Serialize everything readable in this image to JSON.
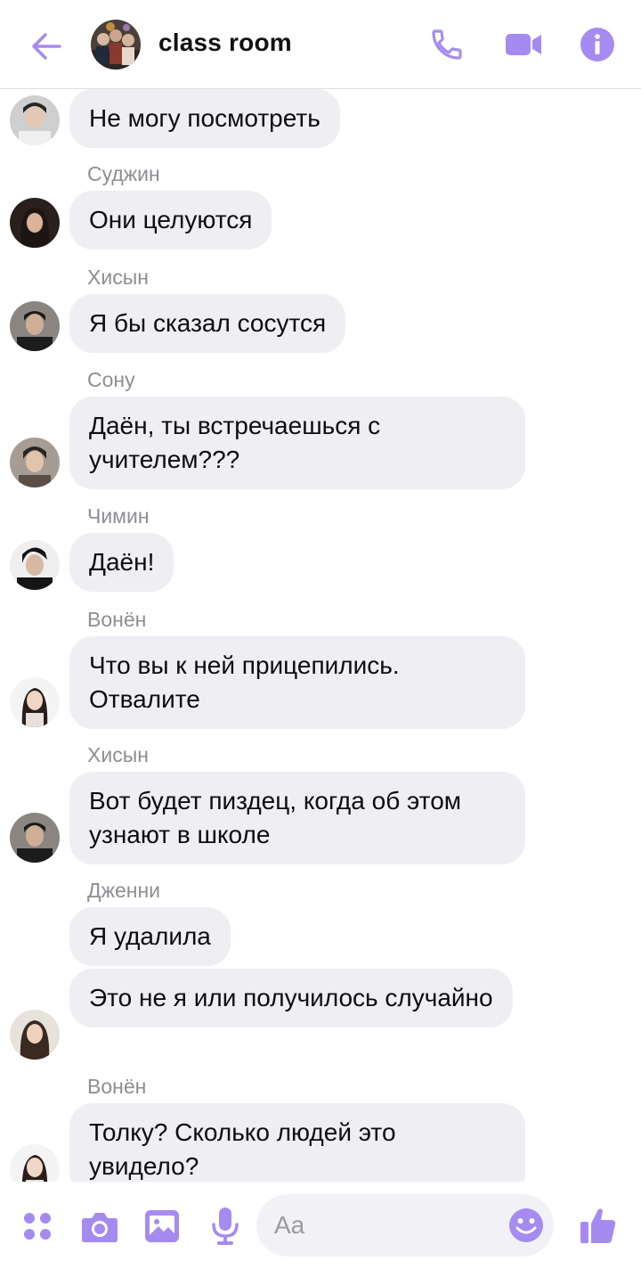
{
  "header": {
    "title": "class room",
    "back_icon": "arrow-left-icon",
    "call_icon": "phone-icon",
    "video_icon": "video-camera-icon",
    "info_icon": "info-icon"
  },
  "colors": {
    "accent": "#a58bf0",
    "bubble": "#efeef3",
    "sender": "#8e8e93"
  },
  "messages": [
    {
      "sender": "",
      "text": "Не могу посмотреть"
    },
    {
      "sender": "Суджин",
      "text": "Они целуются"
    },
    {
      "sender": "Хисын",
      "text": "Я бы сказал сосутся"
    },
    {
      "sender": "Сону",
      "text": "Даён, ты встречаешься с учителем???"
    },
    {
      "sender": "Чимин",
      "text": "Даён!"
    },
    {
      "sender": "Вонён",
      "text": "Что вы к ней прицепились. Отвалите"
    },
    {
      "sender": "Хисын",
      "text": "Вот будет пиздец, когда об этом узнают в школе"
    },
    {
      "sender": "Дженни",
      "text": "Я удалила"
    },
    {
      "sender": "",
      "text": "Это не я или получилось случайно"
    },
    {
      "sender": "Вонён",
      "text": "Толку? Сколько людей это увидело?"
    }
  ],
  "composer": {
    "placeholder": "Aa",
    "icons": [
      "apps-dots-icon",
      "camera-icon",
      "image-icon",
      "microphone-icon",
      "emoji-icon",
      "thumbs-up-icon"
    ]
  }
}
